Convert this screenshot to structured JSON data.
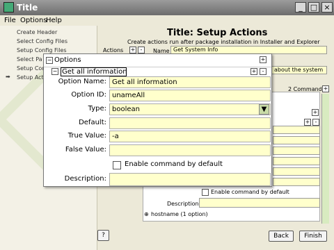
{
  "window": {
    "title": "Title",
    "minimize": "_",
    "maximize": "□",
    "close": "×"
  },
  "menu": [
    "File",
    "Options",
    "Help"
  ],
  "sidebar": {
    "steps": [
      "Create Header",
      "Select Config Files",
      "Setup Config Files",
      "Select Pa",
      "Setup Con",
      "Setup Acti"
    ],
    "active_index": 5
  },
  "main": {
    "heading": "Title: Setup Actions",
    "subtitle": "Create actions run after package installation in Installer and Explorer",
    "actions_label": "Actions",
    "name_label": "Name",
    "name_value": "Get System Info",
    "about_text": "about the system",
    "commands_count": "2 Commands",
    "enable_label": "Enable command by default",
    "description_label": "Description:",
    "hostname_item": "hostname (1 option)"
  },
  "dialog": {
    "options_title": "Options",
    "group_label": "Get all information",
    "option_name_label": "Option Name:",
    "option_name_value": "Get all information",
    "option_id_label": "Option ID:",
    "option_id_value": "unameAll",
    "type_label": "Type:",
    "type_value": "boolean",
    "default_label": "Default:",
    "default_value": "",
    "true_value_label": "True Value:",
    "true_value": "-a",
    "false_value_label": "False Value:",
    "false_value": "",
    "enable_label": "Enable command by default",
    "description_label": "Description:",
    "description_value": ""
  },
  "buttons": {
    "help": "?",
    "back": "Back",
    "finish": "Finish"
  },
  "colors": {
    "field_bg": "#ffffcc",
    "title_bar": "#808080",
    "highlight": "#ffffcc"
  }
}
